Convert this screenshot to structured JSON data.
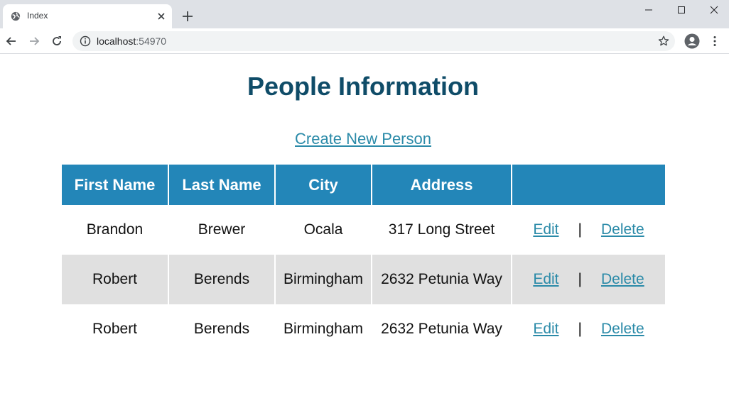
{
  "browser": {
    "tab_title": "Index",
    "url_host": "localhost",
    "url_port": ":54970"
  },
  "page": {
    "title": "People Information",
    "create_link": "Create New Person"
  },
  "table": {
    "headers": [
      "First Name",
      "Last Name",
      "City",
      "Address",
      ""
    ],
    "rows": [
      {
        "first": "Brandon",
        "last": "Brewer",
        "city": "Ocala",
        "address": "317 Long Street"
      },
      {
        "first": "Robert",
        "last": "Berends",
        "city": "Birmingham",
        "address": "2632 Petunia Way"
      },
      {
        "first": "Robert",
        "last": "Berends",
        "city": "Birmingham",
        "address": "2632 Petunia Way"
      }
    ],
    "edit_label": "Edit",
    "separator": "|",
    "delete_label": "Delete"
  },
  "colors": {
    "header_bg": "#2386b8",
    "title_color": "#0f4c68",
    "link_color": "#2a8aa8",
    "alt_row_bg": "#e0e0e0"
  }
}
